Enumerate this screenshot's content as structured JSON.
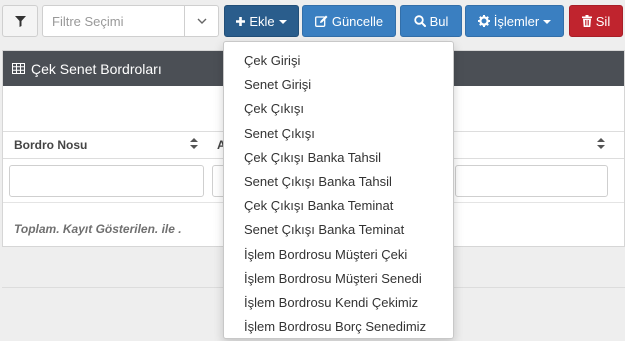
{
  "toolbar": {
    "filter_placeholder": "Filtre Seçimi",
    "buttons": {
      "ekle": "Ekle",
      "guncelle": "Güncelle",
      "bul": "Bul",
      "islemler": "İşlemler",
      "sil": "Sil"
    }
  },
  "panel": {
    "title": "Çek Senet Bordroları",
    "columns": [
      "Bordro Nosu",
      "A"
    ],
    "footer": "Toplam. Kayıt Gösterilen. ile ."
  },
  "dropdown": {
    "items": [
      "Çek Girişi",
      "Senet Girişi",
      "Çek Çıkışı",
      "Senet Çıkışı",
      "Çek Çıkışı Banka Tahsil",
      "Senet Çıkışı Banka Tahsil",
      "Çek Çıkışı Banka Teminat",
      "Senet Çıkışı Banka Teminat",
      "İşlem Bordrosu Müşteri Çeki",
      "İşlem Bordrosu Müşteri Senedi",
      "İşlem Bordrosu Kendi Çekimiz",
      "İşlem Bordrosu Borç Senedimiz"
    ]
  },
  "icons": [
    "filter-icon",
    "chevron-down-icon",
    "plus-icon",
    "edit-icon",
    "search-icon",
    "gear-icon",
    "trash-icon",
    "table-icon",
    "sort-icon"
  ],
  "colors": {
    "ekle": "#2a5d8c",
    "primary": "#3a7fc1",
    "danger": "#c0242e",
    "panel_header": "#4b4f55"
  }
}
